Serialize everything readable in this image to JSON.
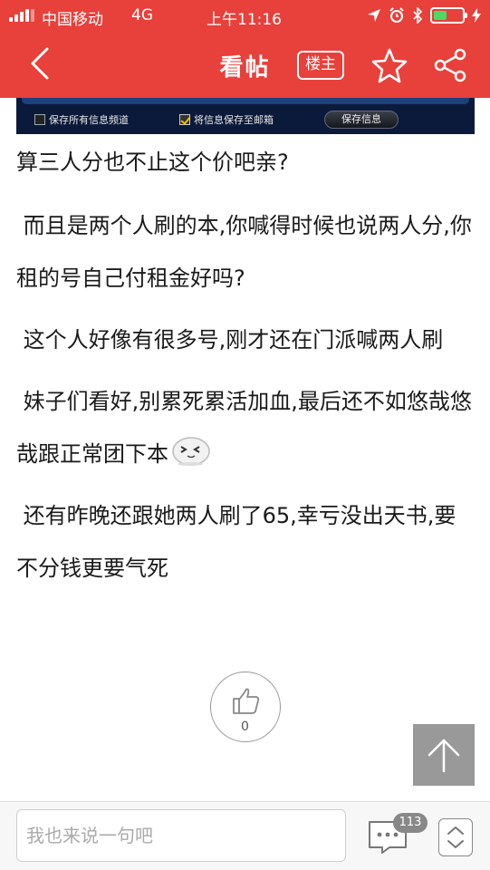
{
  "status_bar": {
    "carrier": "中国移动",
    "network": "4G",
    "time": "上午11:16",
    "battery_level": 0.45
  },
  "header": {
    "title": "看帖",
    "owner_label": "楼主"
  },
  "embedded_image": {
    "option_1": "保存所有信息频道",
    "option_2": "将信息保存至邮箱",
    "save_button": "保存信息"
  },
  "post": {
    "paragraphs": [
      "算三人分也不止这个价吧亲?",
      "而且是两个人刷的本,你喊得时候也说两人分,你租的号自己付租金好吗?",
      "这个人好像有很多号,刚才还在门派喊两人刷",
      "妹子们看好,别累死累活加血,最后还不如悠哉悠哉跟正常团下本",
      "还有昨晚还跟她两人刷了65,幸亏没出天书,要不分钱更要气死"
    ]
  },
  "like": {
    "count": "0"
  },
  "bottom": {
    "reply_placeholder": "我也来说一句吧",
    "comment_count": "113"
  },
  "colors": {
    "header_bg": "#e8403a",
    "accent": "#e8403a",
    "back_to_top_bg": "#999999"
  },
  "icons": {
    "back": "chevron-left-icon",
    "favorite": "star-icon",
    "share": "share-icon",
    "like": "thumbs-up-icon",
    "to_top": "arrow-up-icon",
    "comments": "comment-bubble-icon",
    "pager": "chevron-up-down-icon"
  }
}
